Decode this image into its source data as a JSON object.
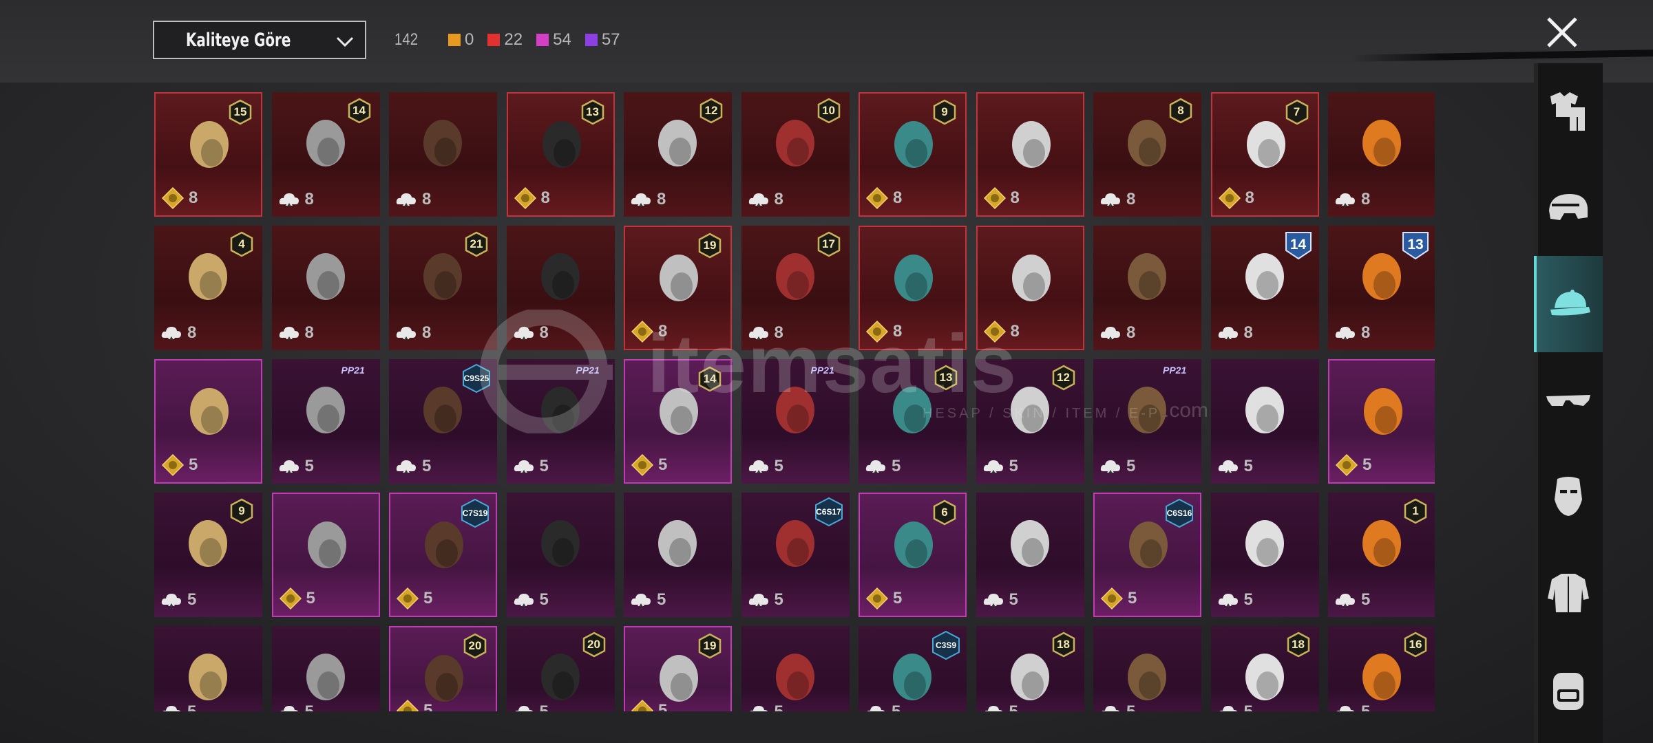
{
  "filter": {
    "sort_label": "Kaliteye Göre"
  },
  "counts": {
    "total": "142",
    "colors": [
      {
        "color": "#e79a1f",
        "value": "0"
      },
      {
        "color": "#e2312f",
        "value": "22"
      },
      {
        "color": "#d53fc6",
        "value": "54"
      },
      {
        "color": "#8c3fe3",
        "value": "57"
      }
    ]
  },
  "watermark": {
    "text": "itemsatis",
    "sub": "HESAP / SKIN / ITEM / E-P",
    "suffix": ".com"
  },
  "sidebar": {
    "categories": [
      "outfit-icon",
      "helmet-icon",
      "cap-icon",
      "glasses-icon",
      "mask-icon",
      "jacket-icon",
      "backpack-icon"
    ],
    "active_index": 2
  },
  "items": [
    {
      "tier": "red",
      "owned": true,
      "level": "15",
      "cost_icon": "gold",
      "cost": "8",
      "art": "blonde-pink-hair-flowers"
    },
    {
      "tier": "red",
      "owned": false,
      "level": "14",
      "cost_icon": "cloud",
      "cost": "8",
      "art": "black-cat-mask"
    },
    {
      "tier": "red",
      "owned": false,
      "level": "",
      "cost_icon": "cloud",
      "cost": "8",
      "art": "gold-mask-helmet"
    },
    {
      "tier": "red",
      "owned": true,
      "level": "13",
      "cost_icon": "gold",
      "cost": "8",
      "art": "brown-hair-hat"
    },
    {
      "tier": "red",
      "owned": false,
      "level": "12",
      "cost_icon": "cloud",
      "cost": "8",
      "art": "gray-buns-hair"
    },
    {
      "tier": "red",
      "owned": false,
      "level": "10",
      "cost_icon": "cloud",
      "cost": "8",
      "art": "dark-hair-tied"
    },
    {
      "tier": "red",
      "owned": true,
      "level": "9",
      "cost_icon": "gold",
      "cost": "8",
      "art": "zombie-head"
    },
    {
      "tier": "red",
      "owned": true,
      "level": "",
      "cost_icon": "gold",
      "cost": "8",
      "art": "white-cowboy-hat"
    },
    {
      "tier": "red",
      "owned": false,
      "level": "8",
      "cost_icon": "cloud",
      "cost": "8",
      "art": "silver-bob-hair"
    },
    {
      "tier": "red",
      "owned": true,
      "level": "7",
      "cost_icon": "gold",
      "cost": "8",
      "art": "white-long-hair"
    },
    {
      "tier": "red",
      "owned": false,
      "level": "",
      "cost_icon": "cloud",
      "cost": "8",
      "art": "red-helmet"
    },
    {
      "tier": "red",
      "owned": false,
      "level": "4",
      "cost_icon": "cloud",
      "cost": "8",
      "art": "snowman-tophat"
    },
    {
      "tier": "red",
      "owned": false,
      "level": "",
      "cost_icon": "cloud",
      "cost": "8",
      "art": "teal-dragon-helm"
    },
    {
      "tier": "red",
      "owned": false,
      "level": "21",
      "cost_icon": "cloud",
      "cost": "8",
      "art": "clown-mask"
    },
    {
      "tier": "red",
      "owned": false,
      "level": "",
      "cost_icon": "cloud",
      "cost": "8",
      "art": "red-horned-mask"
    },
    {
      "tier": "red",
      "owned": true,
      "level": "19",
      "cost_icon": "gold",
      "cost": "8",
      "art": "robot-helmet"
    },
    {
      "tier": "red",
      "owned": false,
      "level": "17",
      "cost_icon": "cloud",
      "cost": "8",
      "art": "silver-ponytail"
    },
    {
      "tier": "red",
      "owned": true,
      "level": "",
      "cost_icon": "gold",
      "cost": "8",
      "art": "red-visor-helmet"
    },
    {
      "tier": "red",
      "owned": true,
      "level": "",
      "cost_icon": "gold",
      "cost": "8",
      "art": "black-knight-helm"
    },
    {
      "tier": "red",
      "owned": false,
      "level": "",
      "cost_icon": "cloud",
      "cost": "8",
      "art": "gold-horn-helm"
    },
    {
      "tier": "red",
      "owned": false,
      "level": "14",
      "season": "big",
      "cost_icon": "cloud",
      "cost": "8",
      "art": "officer-cap"
    },
    {
      "tier": "red",
      "owned": false,
      "level": "13",
      "season": "big",
      "cost_icon": "cloud",
      "cost": "8",
      "art": "gas-mask-helm"
    },
    {
      "tier": "pur",
      "owned": true,
      "level": "",
      "cost_icon": "gold",
      "cost": "5",
      "art": "dark-red-hair"
    },
    {
      "tier": "pur",
      "owned": false,
      "level": "",
      "pp": "PP21",
      "cost_icon": "cloud",
      "cost": "5",
      "art": "pink-bow-headband"
    },
    {
      "tier": "pur",
      "owned": false,
      "level": "",
      "season_tag": "C9S25",
      "cost_icon": "cloud",
      "cost": "5",
      "art": "gray-hair-flower"
    },
    {
      "tier": "pur",
      "owned": false,
      "level": "",
      "pp": "PP21",
      "cost_icon": "cloud",
      "cost": "5",
      "art": "yellow-box-head"
    },
    {
      "tier": "pur",
      "owned": true,
      "level": "14",
      "cost_icon": "gold",
      "cost": "5",
      "art": "blonde-hair-flower"
    },
    {
      "tier": "pur",
      "owned": false,
      "level": "",
      "pp": "PP21",
      "cost_icon": "cloud",
      "cost": "5",
      "art": "teal-dark-hair"
    },
    {
      "tier": "pur",
      "owned": false,
      "level": "13",
      "cost_icon": "cloud",
      "cost": "5",
      "art": "goggles-helmet"
    },
    {
      "tier": "pur",
      "owned": false,
      "level": "12",
      "cost_icon": "cloud",
      "cost": "5",
      "art": "orange-braids"
    },
    {
      "tier": "pur",
      "owned": false,
      "level": "",
      "pp": "PP21",
      "cost_icon": "cloud",
      "cost": "5",
      "art": "panda-head"
    },
    {
      "tier": "pur",
      "owned": false,
      "level": "",
      "cost_icon": "cloud",
      "cost": "5",
      "art": "brown-bob"
    },
    {
      "tier": "pur",
      "owned": true,
      "level": "",
      "cost_icon": "gold",
      "cost": "5",
      "art": "pumpkin-head"
    },
    {
      "tier": "pur",
      "owned": false,
      "level": "9",
      "cost_icon": "cloud",
      "cost": "5",
      "art": "black-long-hair"
    },
    {
      "tier": "pur",
      "owned": true,
      "level": "",
      "cost_icon": "gold",
      "cost": "5",
      "art": "golden-long-hair"
    },
    {
      "tier": "pur",
      "owned": true,
      "level": "",
      "season_tag": "C7S19",
      "cost_icon": "gold",
      "cost": "5",
      "art": "blue-dreads"
    },
    {
      "tier": "pur",
      "owned": false,
      "level": "",
      "cost_icon": "cloud",
      "cost": "5",
      "art": "black-gold-helms"
    },
    {
      "tier": "pur",
      "owned": false,
      "level": "",
      "cost_icon": "cloud",
      "cost": "5",
      "art": "white-hood-hair"
    },
    {
      "tier": "pur",
      "owned": false,
      "level": "",
      "season_tag": "C6S17",
      "cost_icon": "cloud",
      "cost": "5",
      "art": "visor-white-hair"
    },
    {
      "tier": "pur",
      "owned": true,
      "level": "6",
      "cost_icon": "gold",
      "cost": "5",
      "art": "white-masked-helm"
    },
    {
      "tier": "pur",
      "owned": false,
      "level": "",
      "cost_icon": "cloud",
      "cost": "5",
      "art": "red-roses"
    },
    {
      "tier": "pur",
      "owned": true,
      "level": "",
      "season_tag": "C6S16",
      "cost_icon": "gold",
      "cost": "5",
      "art": "red-bob-hair"
    },
    {
      "tier": "pur",
      "owned": false,
      "level": "",
      "cost_icon": "cloud",
      "cost": "5",
      "art": "blonde-braids-goggles"
    },
    {
      "tier": "pur",
      "owned": false,
      "level": "1",
      "cost_icon": "cloud",
      "cost": "5",
      "art": "pastel-hair"
    },
    {
      "tier": "pur",
      "owned": false,
      "level": "",
      "cost_icon": "cloud",
      "cost": "5",
      "art": "green-creature"
    },
    {
      "tier": "pur",
      "owned": false,
      "level": "",
      "cost_icon": "cloud",
      "cost": "5",
      "art": "gold-pharaoh"
    },
    {
      "tier": "pur",
      "owned": true,
      "level": "20",
      "cost_icon": "gold",
      "cost": "5",
      "art": "bunny-ears-hair"
    },
    {
      "tier": "pur",
      "owned": false,
      "level": "20",
      "cost_icon": "cloud",
      "cost": "5",
      "art": "black-red-mask"
    },
    {
      "tier": "pur",
      "owned": true,
      "level": "19",
      "cost_icon": "gold",
      "cost": "5",
      "art": "black-bun-hair"
    },
    {
      "tier": "pur",
      "owned": false,
      "level": "",
      "cost_icon": "cloud",
      "cost": "5",
      "art": "gold-dragon-helm"
    },
    {
      "tier": "pur",
      "owned": false,
      "level": "",
      "season_tag": "C3S9",
      "cost_icon": "cloud",
      "cost": "5",
      "art": "bear-bandana"
    },
    {
      "tier": "pur",
      "owned": false,
      "level": "18",
      "cost_icon": "cloud",
      "cost": "5",
      "art": "gray-hair-visor"
    },
    {
      "tier": "pur",
      "owned": false,
      "level": "",
      "cost_icon": "cloud",
      "cost": "5",
      "art": "red-dreads"
    },
    {
      "tier": "pur",
      "owned": false,
      "level": "18",
      "cost_icon": "cloud",
      "cost": "5",
      "art": "black-bunny-hair"
    },
    {
      "tier": "pur",
      "owned": false,
      "level": "16",
      "cost_icon": "cloud",
      "cost": "5",
      "art": "blue-green-creature"
    }
  ]
}
